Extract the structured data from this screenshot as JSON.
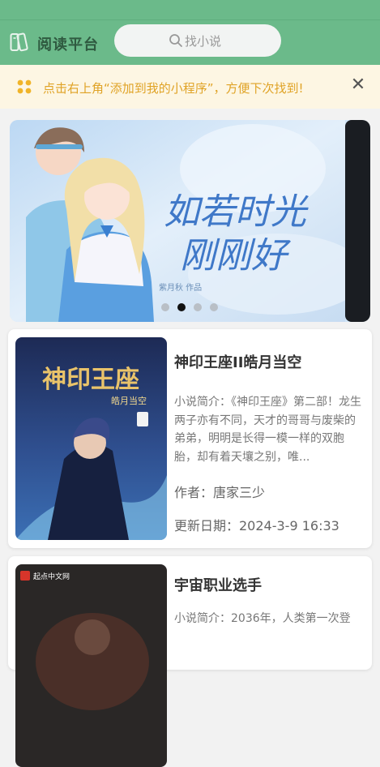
{
  "header": {
    "app_title": "阅读平台",
    "search_placeholder": "找小说",
    "brand_color": "#6bba8a"
  },
  "notice": {
    "text": "点击右上角“添加到我的小程序”，方便下次找到!",
    "close_glyph": "✕",
    "text_color": "#e0a326"
  },
  "banner": {
    "title_art": "如若时光刚刚好",
    "credit": "紫月秋 作品",
    "slide_count": 4,
    "active_slide": 2
  },
  "books": [
    {
      "title": "神印王座II皓月当空",
      "cover_title": "神印王座",
      "cover_subtitle": "皓月当空",
      "desc": "小说简介：《神印王座》第二部！龙生两子亦有不同，天才的哥哥与废柴的弟弟，明明是长得一模一样的双胞胎，却有着天壤之别，唯...",
      "author": "作者：唐家三少",
      "updated": "更新日期：2024-3-9 16:33"
    },
    {
      "title": "宇宙职业选手",
      "cover_badge": "起点中文网",
      "desc": "小说简介：2036年，人类第一次登"
    }
  ]
}
